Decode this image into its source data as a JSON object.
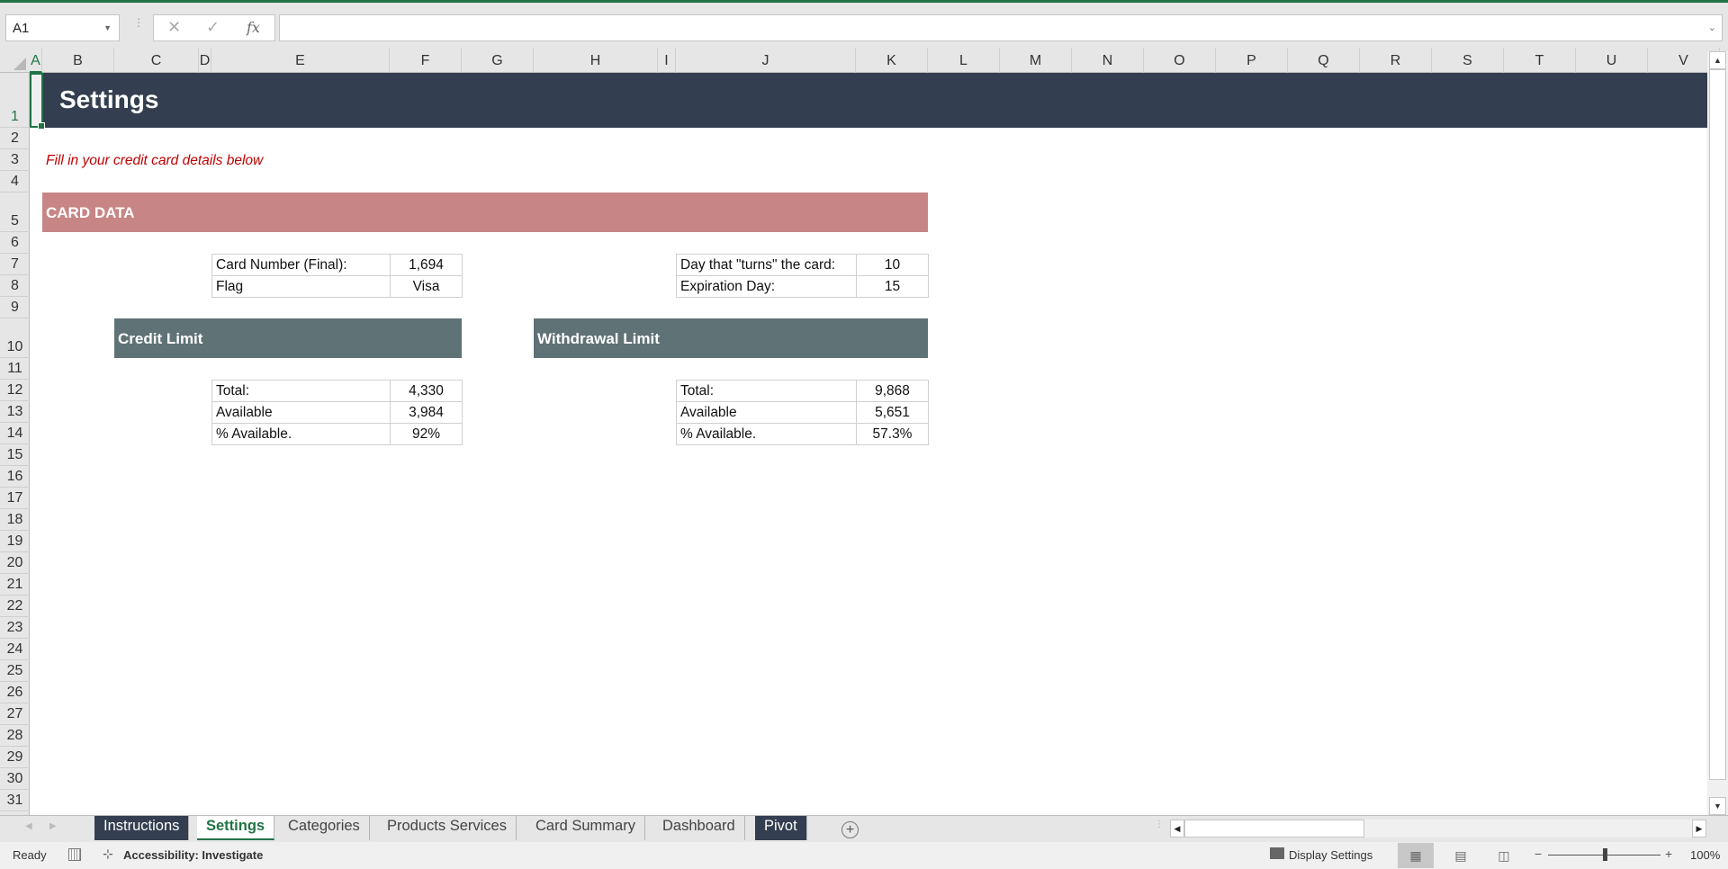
{
  "formula_bar": {
    "name_box": "A1",
    "formula": "",
    "icons": [
      "cancel-icon",
      "enter-icon",
      "function-icon"
    ],
    "fx_label": "fx"
  },
  "columns": [
    "A",
    "B",
    "C",
    "D",
    "E",
    "F",
    "G",
    "H",
    "I",
    "J",
    "K",
    "L",
    "M",
    "N",
    "O",
    "P",
    "Q",
    "R",
    "S",
    "T",
    "U",
    "V"
  ],
  "rows": [
    "1",
    "2",
    "3",
    "4",
    "5",
    "6",
    "7",
    "8",
    "9",
    "10",
    "11",
    "12",
    "13",
    "14",
    "15",
    "16",
    "17",
    "18",
    "19",
    "20",
    "21",
    "22",
    "23",
    "24",
    "25",
    "26",
    "27",
    "28",
    "29",
    "30",
    "31"
  ],
  "sheet": {
    "title": "Settings",
    "hint": "Fill in your credit card details below",
    "card_data": {
      "heading": "CARD DATA",
      "left_table": [
        {
          "label": "Card Number (Final):",
          "value": "1,694"
        },
        {
          "label": "Flag",
          "value": "Visa"
        }
      ],
      "right_table": [
        {
          "label": "Day that \"turns\" the card:",
          "value": "10"
        },
        {
          "label": "Expiration Day:",
          "value": "15"
        }
      ]
    },
    "credit_limit": {
      "heading": "Credit Limit",
      "rows": [
        {
          "label": "Total:",
          "value": "4,330"
        },
        {
          "label": "Available",
          "value": "3,984"
        },
        {
          "label": "% Available.",
          "value": "92%"
        }
      ]
    },
    "withdrawal_limit": {
      "heading": "Withdrawal Limit",
      "rows": [
        {
          "label": "Total:",
          "value": "9,868"
        },
        {
          "label": "Available",
          "value": "5,651"
        },
        {
          "label": "% Available.",
          "value": "57.3%"
        }
      ]
    }
  },
  "tabs": [
    {
      "label": "Instructions",
      "style": "dark"
    },
    {
      "label": "Settings",
      "style": "active"
    },
    {
      "label": "Categories",
      "style": "normal"
    },
    {
      "label": "Products Services",
      "style": "normal"
    },
    {
      "label": "Card Summary",
      "style": "normal"
    },
    {
      "label": "Dashboard",
      "style": "normal"
    },
    {
      "label": "Pivot",
      "style": "dark"
    }
  ],
  "status_bar": {
    "ready": "Ready",
    "accessibility": "Accessibility: Investigate",
    "display_settings": "Display Settings",
    "zoom": "100%"
  },
  "colors": {
    "title_band": "#333f50",
    "card_band": "#c78585",
    "section_band": "#5f7275",
    "hint_text": "#c00000",
    "accent": "#217346"
  }
}
